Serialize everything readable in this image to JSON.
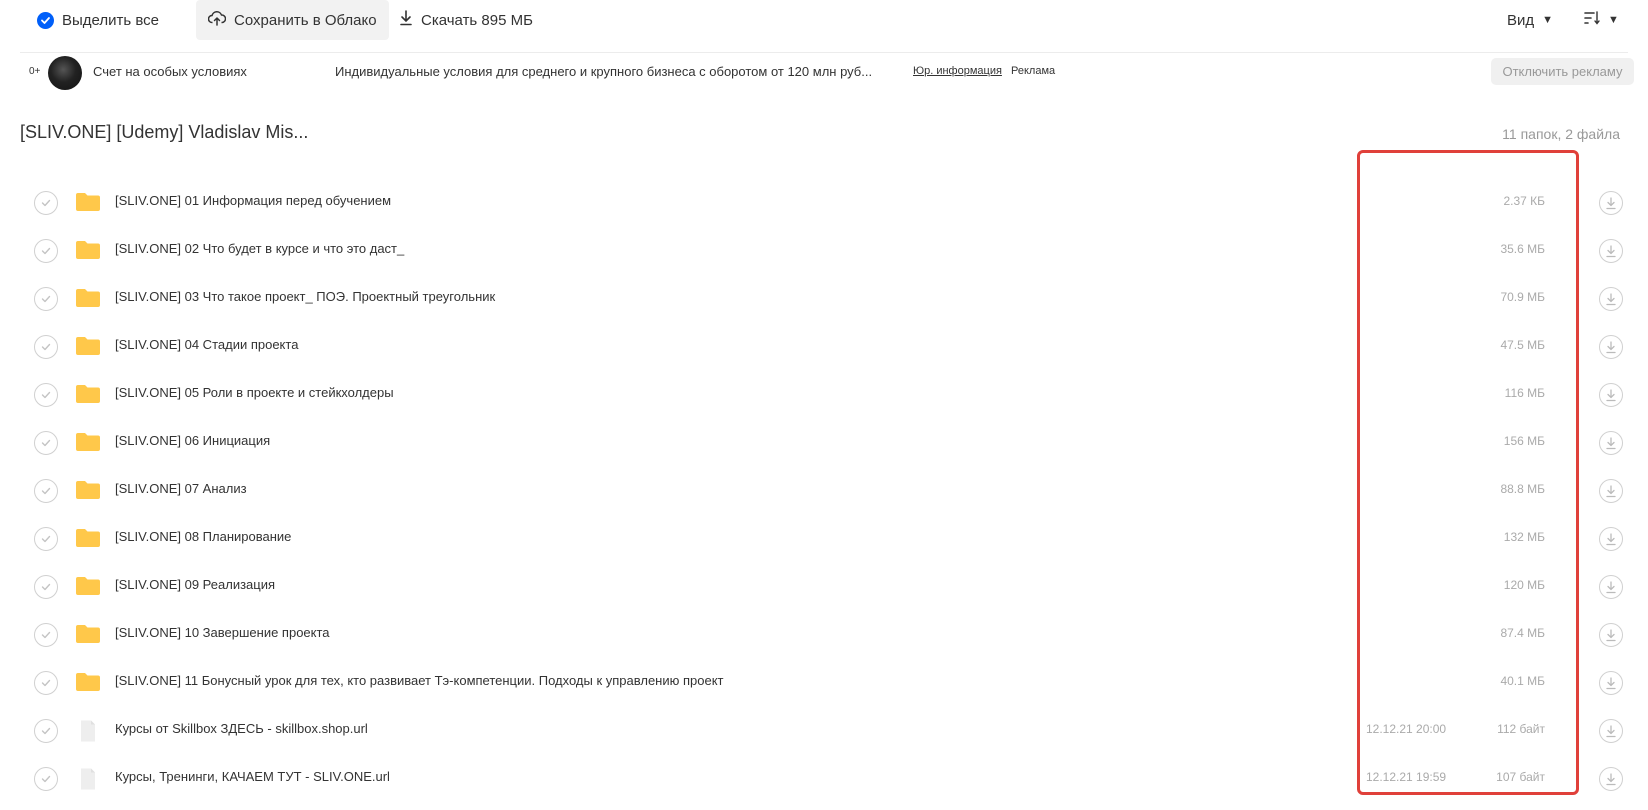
{
  "toolbar": {
    "select_all_label": "Выделить все",
    "save_cloud_label": "Сохранить в Облако",
    "download_label": "Скачать 895 МБ",
    "view_label": "Вид"
  },
  "ad": {
    "age_rating": "0+",
    "title": "Счет на особых условиях",
    "description": "Индивидуальные условия для среднего и крупного бизнеса с оборотом от 120 млн руб...",
    "legal_link": "Юр. информация",
    "ad_label": "Реклама",
    "disable_button": "Отключить рекламу"
  },
  "folder": {
    "title": "[SLIV.ONE] [Udemy] Vladislav Mis...",
    "count": "11 папок, 2 файла"
  },
  "items": [
    {
      "type": "folder",
      "name": "[SLIV.ONE] 01 Информация перед обучением",
      "date": "",
      "size": "2.37 КБ"
    },
    {
      "type": "folder",
      "name": "[SLIV.ONE] 02 Что будет в курсе и что это даст_",
      "date": "",
      "size": "35.6 МБ"
    },
    {
      "type": "folder",
      "name": "[SLIV.ONE] 03 Что такое проект_ ПОЭ. Проектный треугольник",
      "date": "",
      "size": "70.9 МБ"
    },
    {
      "type": "folder",
      "name": "[SLIV.ONE] 04 Стадии проекта",
      "date": "",
      "size": "47.5 МБ"
    },
    {
      "type": "folder",
      "name": "[SLIV.ONE] 05 Роли в проекте и стейкхолдеры",
      "date": "",
      "size": "116 МБ"
    },
    {
      "type": "folder",
      "name": "[SLIV.ONE] 06 Инициация",
      "date": "",
      "size": "156 МБ"
    },
    {
      "type": "folder",
      "name": "[SLIV.ONE] 07 Анализ",
      "date": "",
      "size": "88.8 МБ"
    },
    {
      "type": "folder",
      "name": "[SLIV.ONE] 08 Планирование",
      "date": "",
      "size": "132 МБ"
    },
    {
      "type": "folder",
      "name": "[SLIV.ONE] 09 Реализация",
      "date": "",
      "size": "120 МБ"
    },
    {
      "type": "folder",
      "name": "[SLIV.ONE] 10 Завершение проекта",
      "date": "",
      "size": "87.4 МБ"
    },
    {
      "type": "folder",
      "name": "[SLIV.ONE] 11 Бонусный урок для тех, кто развивает Тэ-компетенции. Подходы к управлению проект",
      "date": "",
      "size": "40.1 МБ"
    },
    {
      "type": "file",
      "name": "Курсы от Skillbox ЗДЕСЬ - skillbox.shop.url",
      "date": "12.12.21 20:00",
      "size": "112 байт"
    },
    {
      "type": "file",
      "name": "Курсы, Тренинги, КАЧАЕМ ТУТ - SLIV.ONE.url",
      "date": "12.12.21 19:59",
      "size": "107 байт"
    }
  ],
  "colors": {
    "accent": "#005ff9",
    "folder": "#ffc84a",
    "highlight": "#e0403a",
    "muted_text": "#aaaaaa"
  }
}
